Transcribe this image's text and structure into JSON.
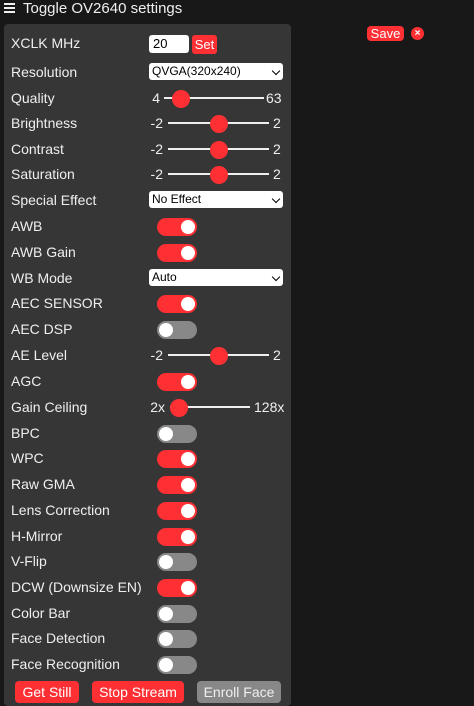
{
  "header": {
    "title": "Toggle OV2640 settings"
  },
  "save": {
    "label": "Save",
    "close": "×"
  },
  "xclk": {
    "label": "XCLK MHz",
    "value": "20",
    "button": "Set"
  },
  "resolution": {
    "label": "Resolution",
    "value": "QVGA(320x240)"
  },
  "quality": {
    "label": "Quality",
    "min": "4",
    "max": "63",
    "value": 10
  },
  "brightness": {
    "label": "Brightness",
    "min": "-2",
    "max": "2",
    "value": 0
  },
  "contrast": {
    "label": "Contrast",
    "min": "-2",
    "max": "2",
    "value": 0
  },
  "saturation": {
    "label": "Saturation",
    "min": "-2",
    "max": "2",
    "value": 0
  },
  "special_effect": {
    "label": "Special Effect",
    "value": "No Effect"
  },
  "awb": {
    "label": "AWB",
    "on": true
  },
  "awb_gain": {
    "label": "AWB Gain",
    "on": true
  },
  "wb_mode": {
    "label": "WB Mode",
    "value": "Auto"
  },
  "aec_sensor": {
    "label": "AEC SENSOR",
    "on": true
  },
  "aec_dsp": {
    "label": "AEC DSP",
    "on": false
  },
  "ae_level": {
    "label": "AE Level",
    "min": "-2",
    "max": "2",
    "value": 0
  },
  "agc": {
    "label": "AGC",
    "on": true
  },
  "gain_ceiling": {
    "label": "Gain Ceiling",
    "min": "2x",
    "max": "128x",
    "value": 0
  },
  "bpc": {
    "label": "BPC",
    "on": false
  },
  "wpc": {
    "label": "WPC",
    "on": true
  },
  "raw_gma": {
    "label": "Raw GMA",
    "on": true
  },
  "lens_correction": {
    "label": "Lens Correction",
    "on": true
  },
  "h_mirror": {
    "label": "H-Mirror",
    "on": true
  },
  "v_flip": {
    "label": "V-Flip",
    "on": false
  },
  "dcw": {
    "label": "DCW (Downsize EN)",
    "on": true
  },
  "color_bar": {
    "label": "Color Bar",
    "on": false
  },
  "face_detection": {
    "label": "Face Detection",
    "on": false
  },
  "face_recognition": {
    "label": "Face Recognition",
    "on": false
  },
  "buttons": {
    "get_still": "Get Still",
    "stop_stream": "Stop Stream",
    "enroll_face": "Enroll Face"
  },
  "colors": {
    "accent": "#ff3034",
    "panel": "#363636",
    "background": "#181818",
    "toggle_off": "#888888"
  }
}
